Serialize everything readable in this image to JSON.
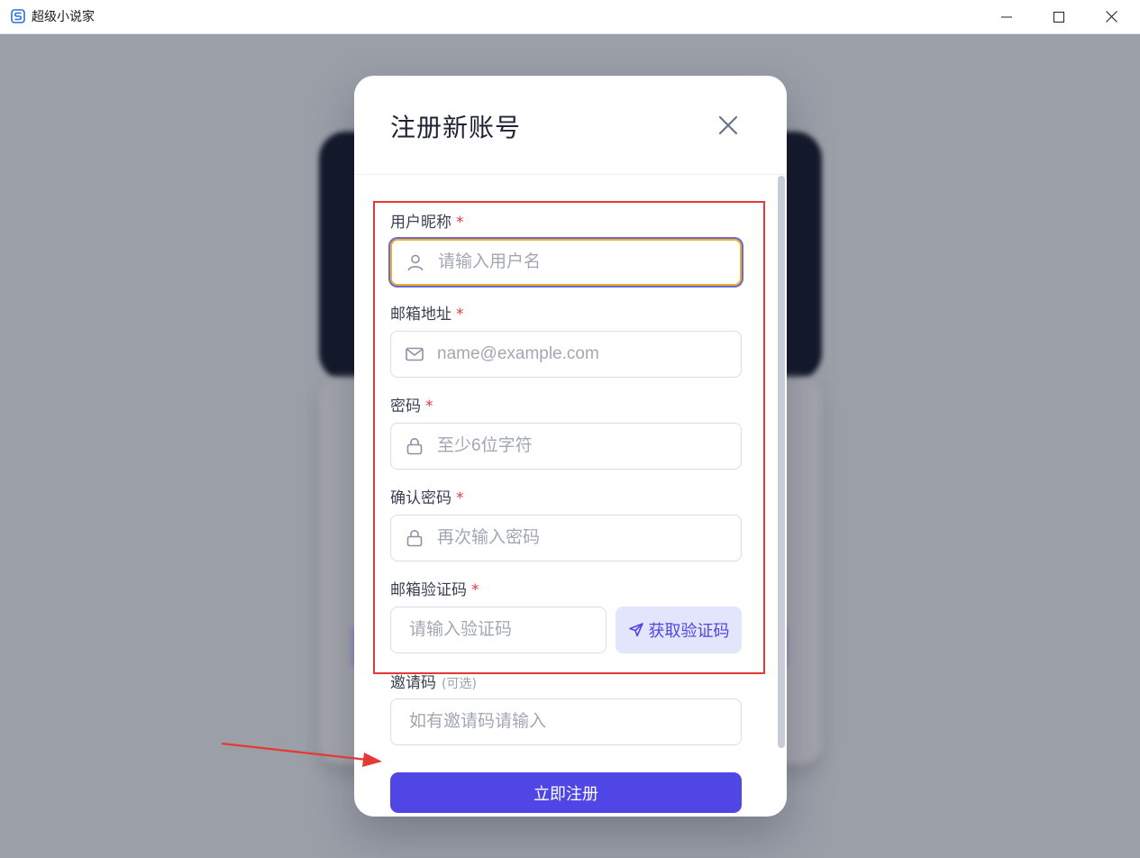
{
  "window": {
    "title": "超级小说家",
    "logo_icon": "app-logo-icon"
  },
  "modal": {
    "title": "注册新账号",
    "fields": {
      "nickname": {
        "label": "用户昵称",
        "required": "*",
        "placeholder": "请输入用户名",
        "icon": "user-icon"
      },
      "email": {
        "label": "邮箱地址",
        "required": "*",
        "placeholder": "name@example.com",
        "icon": "mail-icon"
      },
      "password": {
        "label": "密码",
        "required": "*",
        "placeholder": "至少6位字符",
        "icon": "lock-icon"
      },
      "confirm_password": {
        "label": "确认密码",
        "required": "*",
        "placeholder": "再次输入密码",
        "icon": "lock-icon"
      },
      "email_code": {
        "label": "邮箱验证码",
        "required": "*",
        "placeholder": "请输入验证码",
        "send_label": "获取验证码"
      },
      "invite_code": {
        "label": "邀请码",
        "optional": "(可选)",
        "placeholder": "如有邀请码请输入"
      }
    },
    "submit_label": "立即注册"
  },
  "colors": {
    "accent": "#4f46e5",
    "accent_light": "#e3e5fc",
    "required": "#e0393f",
    "annotation": "#e53935"
  }
}
